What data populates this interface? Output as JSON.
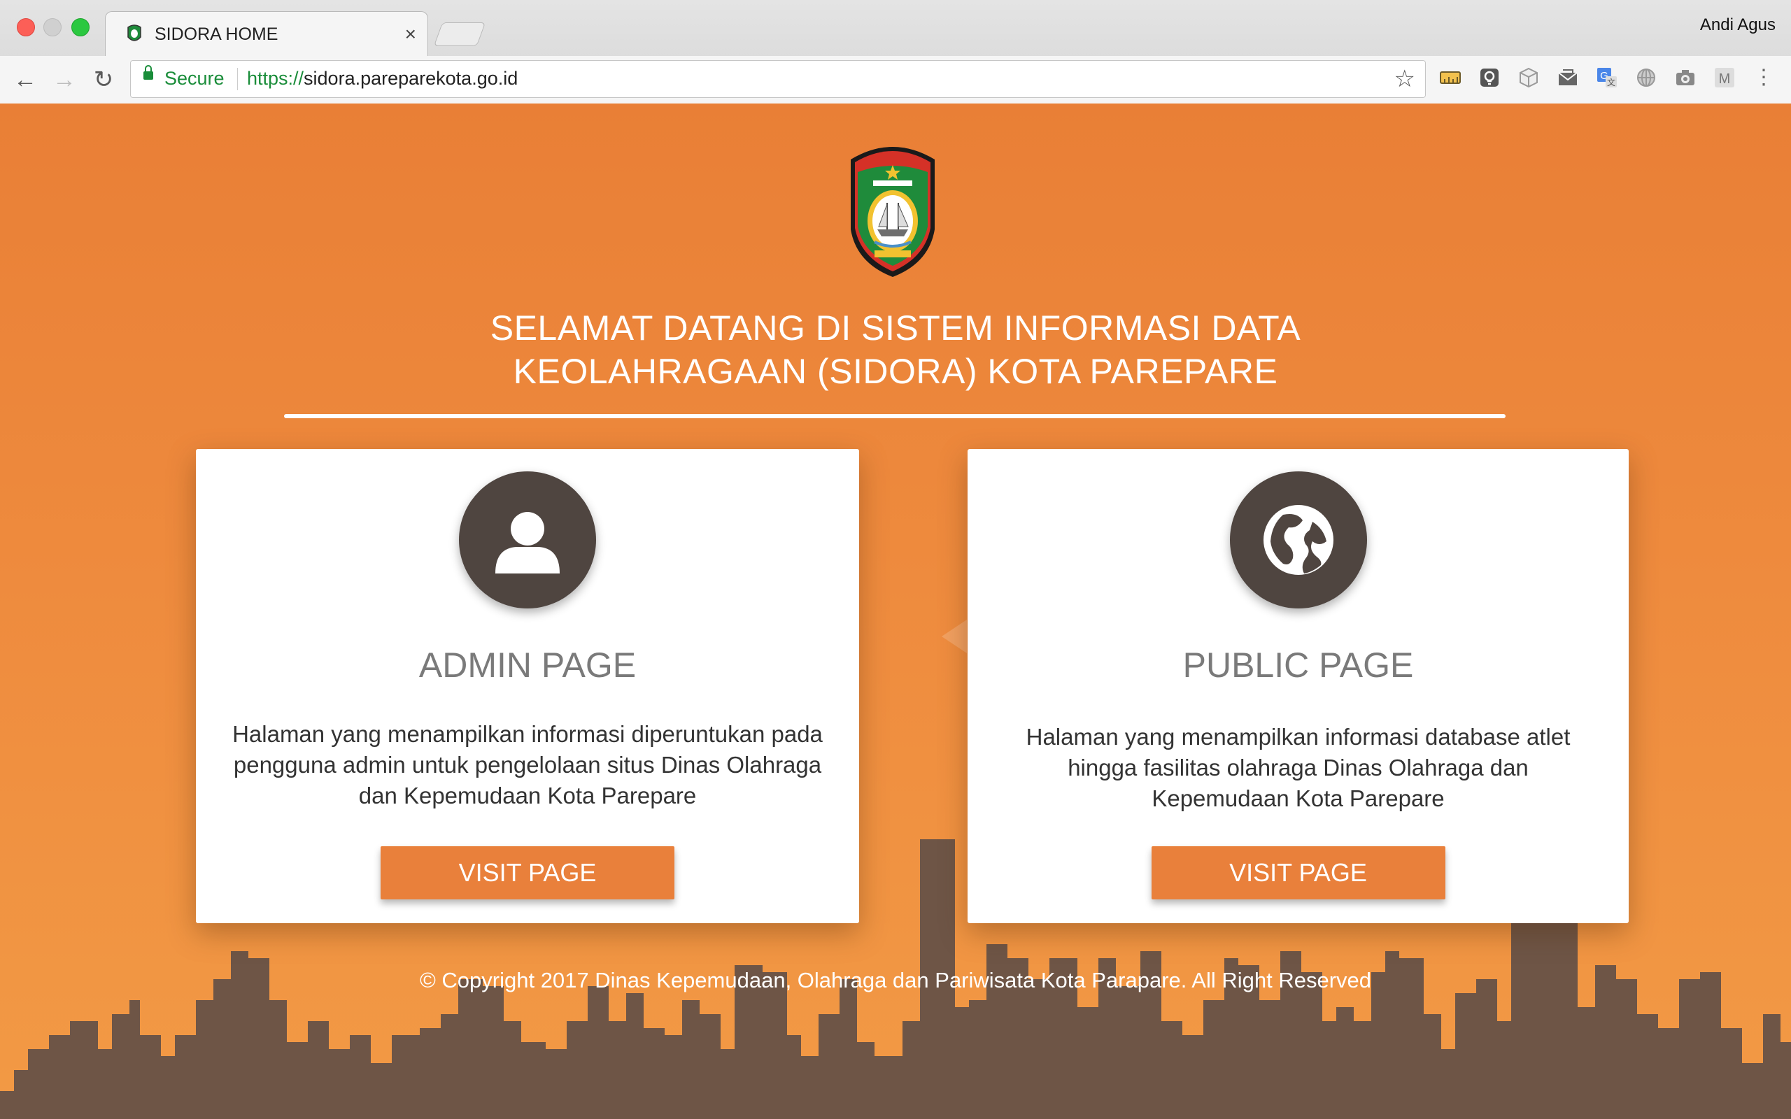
{
  "browser": {
    "tab_title": "SIDORA HOME",
    "tab_close": "×",
    "profile_name": "Andi Agus",
    "secure_label": "Secure",
    "url_scheme": "https://",
    "url_host": "sidora.pareparekota.go.id",
    "extensions": [
      "ruler-icon",
      "bulb-icon",
      "cube-icon",
      "mail-icon",
      "translate-icon",
      "globe-icon",
      "camera-icon",
      "m-icon",
      "menu-icon"
    ]
  },
  "page": {
    "welcome_line1": "SELAMAT DATANG DI SISTEM INFORMASI DATA",
    "welcome_line2": "KEOLAHRAGAAN (SIDORA) KOTA PAREPARE",
    "cards": [
      {
        "title": "ADMIN PAGE",
        "description": "Halaman yang menampilkan informasi diperuntukan pada pengguna admin untuk pengelolaan situs Dinas Olahraga dan Kepemudaan Kota Parepare",
        "button": "VISIT PAGE",
        "icon": "user-icon"
      },
      {
        "title": "PUBLIC PAGE",
        "description": "Halaman yang menampilkan informasi database atlet hingga fasilitas olahraga Dinas Olahraga dan Kepemudaan Kota Parepare",
        "button": "VISIT PAGE",
        "icon": "globe-icon"
      }
    ],
    "copyright": "© Copyright  2017 Dinas Kepemudaan, Olahraga dan Pariwisata Kota Parapare. All Right Reserved"
  },
  "colors": {
    "accent": "#e9803b",
    "icon_circle": "#4f4540",
    "skyline": "#6e5546",
    "secure_green": "#1a8d3a"
  }
}
